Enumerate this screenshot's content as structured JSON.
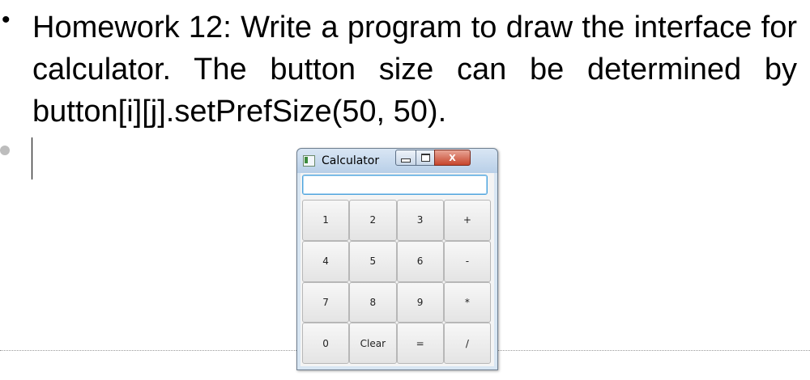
{
  "slide": {
    "bullet_text": "Homework 12: Write a program to draw the interface for calculator. The button size can be determined by button[i][j].setPrefSize(50, 50).",
    "bullet_symbol": "•"
  },
  "window": {
    "title": "Calculator",
    "close_symbol": "X",
    "display_value": ""
  },
  "keypad": {
    "keys": [
      "1",
      "2",
      "3",
      "+",
      "4",
      "5",
      "6",
      "-",
      "7",
      "8",
      "9",
      "*",
      "0",
      "Clear",
      "=",
      "/"
    ]
  },
  "colors": {
    "titlebar": "#c9dcef",
    "close_button": "#c7452c",
    "field_focus": "#4da3dc"
  },
  "icons": [
    "app-icon",
    "minimize-icon",
    "maximize-icon",
    "close-icon"
  ]
}
